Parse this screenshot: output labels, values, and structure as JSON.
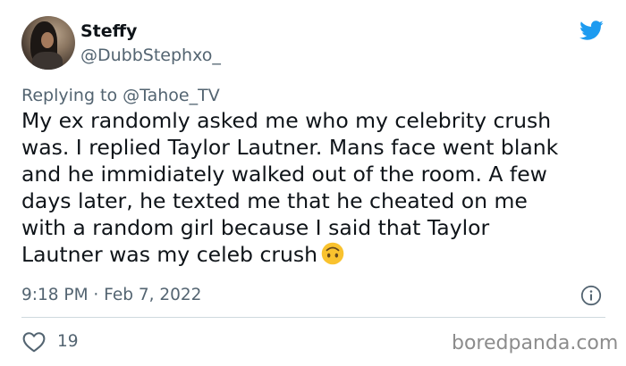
{
  "tweet": {
    "author": {
      "display_name": "Steffy",
      "handle": "@DubbStephxo_",
      "avatar": "profile-photo"
    },
    "replying_to": "Replying to @Tahoe_TV",
    "text": "My ex randomly asked me who my celebrity crush\nwas. I replied Taylor Lautner. Mans face went blank\nand he immidiately walked out of the room. A few\ndays later, he texted me that he cheated on me\nwith a random girl because I said that Taylor\nLautner was my celeb crush",
    "emoji": "upside-down-face-emoji",
    "timestamp": "9:18 PM · Feb 7, 2022",
    "likes": "19"
  },
  "icons": {
    "platform": "twitter-bird-icon",
    "info": "info-icon",
    "like": "heart-icon"
  },
  "watermark": "boredpanda.com",
  "colors": {
    "twitter_blue": "#1d9bf0",
    "secondary_text": "#536471",
    "primary_text": "#0f1419",
    "divider": "#cfd9de",
    "emoji_yellow": "#f9c22e"
  }
}
